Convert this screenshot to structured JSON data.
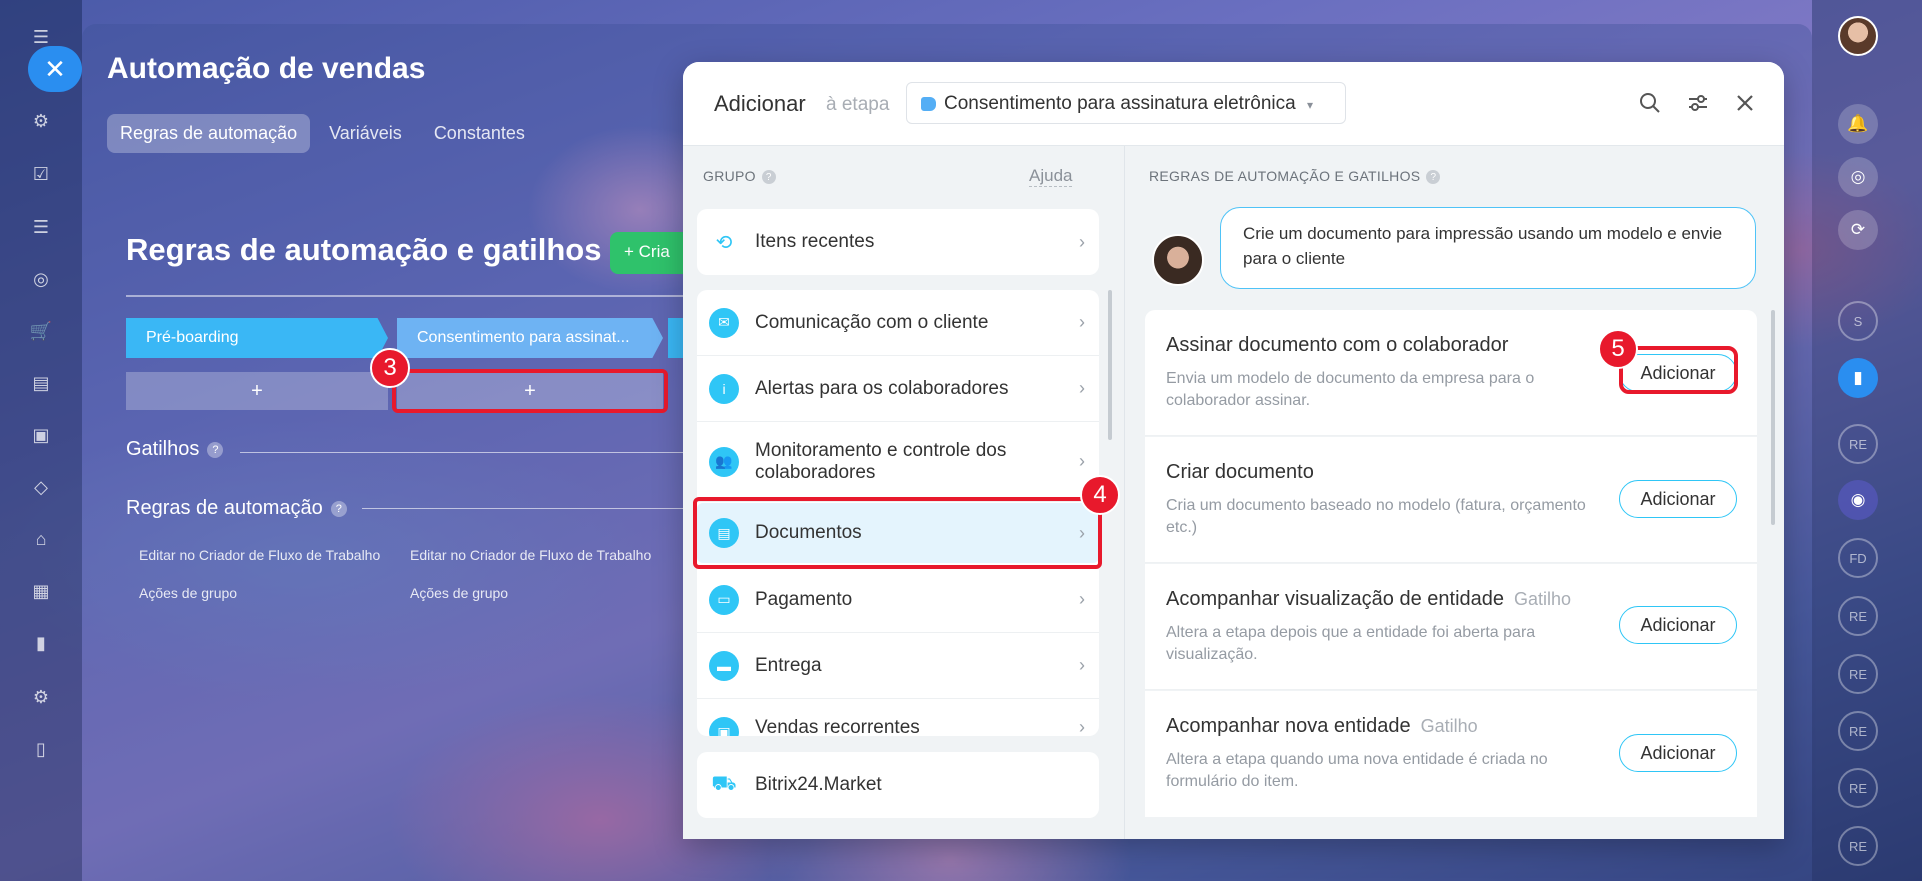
{
  "base": {
    "title": "Automação de vendas",
    "tabs": [
      {
        "label": "Regras de automação"
      },
      {
        "label": "Variáveis"
      },
      {
        "label": "Constantes"
      }
    ],
    "section_title": "Regras de automação e gatilhos",
    "create_button": "+ Cria",
    "stages": [
      "Pré-boarding",
      "Consentimento para assinat..."
    ],
    "plus": "+",
    "triggers_label": "Gatilhos",
    "rules_label": "Regras de automação",
    "links": {
      "edit_flow": "Editar no Criador de Fluxo de Trabalho",
      "group_actions": "Ações de grupo"
    }
  },
  "badges": {
    "b3": "3",
    "b4": "4",
    "b5": "5"
  },
  "right_rail": {
    "initials": [
      "S",
      "RE",
      "FD",
      "RE",
      "RE",
      "RE",
      "RE",
      "RE"
    ]
  },
  "modal": {
    "title": "Adicionar",
    "subtitle": "à etapa",
    "stage_selected": "Consentimento para assinatura eletrônica",
    "group_label": "GRUPO",
    "groups": [
      {
        "label": "Itens recentes",
        "icon": "history-icon",
        "color": "#2fc6f6"
      },
      {
        "label": "Comunicação com o cliente",
        "icon": "chat-icon",
        "color": "#2fc6f6"
      },
      {
        "label": "Alertas para os colaboradores",
        "icon": "info-icon",
        "color": "#2fc6f6"
      },
      {
        "label": "Monitoramento e controle dos colaboradores",
        "icon": "users-icon",
        "color": "#2fc6f6"
      },
      {
        "label": "Documentos",
        "icon": "document-icon",
        "color": "#2fc6f6"
      },
      {
        "label": "Pagamento",
        "icon": "wallet-icon",
        "color": "#2fc6f6"
      },
      {
        "label": "Entrega",
        "icon": "truck-icon",
        "color": "#2fc6f6"
      },
      {
        "label": "Vendas recorrentes",
        "icon": "cart-icon",
        "color": "#2fc6f6"
      }
    ],
    "market": "Bitrix24.Market",
    "right_label": "REGRAS DE AUTOMAÇÃO E GATILHOS",
    "help": "Ajuda",
    "hint": "Crie um documento para impressão usando um modelo e envie para o cliente",
    "actions": [
      {
        "title": "Assinar documento com o colaborador",
        "tag": "",
        "desc": "Envia um modelo de documento da empresa para o colaborador assinar.",
        "button": "Adicionar"
      },
      {
        "title": "Criar documento",
        "tag": "",
        "desc": "Cria um documento baseado no modelo (fatura, orçamento etc.)",
        "button": "Adicionar"
      },
      {
        "title": "Acompanhar visualização de entidade",
        "tag": "Gatilho",
        "desc": "Altera a etapa depois que a entidade foi aberta para visualização.",
        "button": "Adicionar"
      },
      {
        "title": "Acompanhar nova entidade",
        "tag": "Gatilho",
        "desc": "Altera a etapa quando uma nova entidade é criada no formulário do item.",
        "button": "Adicionar"
      }
    ]
  }
}
